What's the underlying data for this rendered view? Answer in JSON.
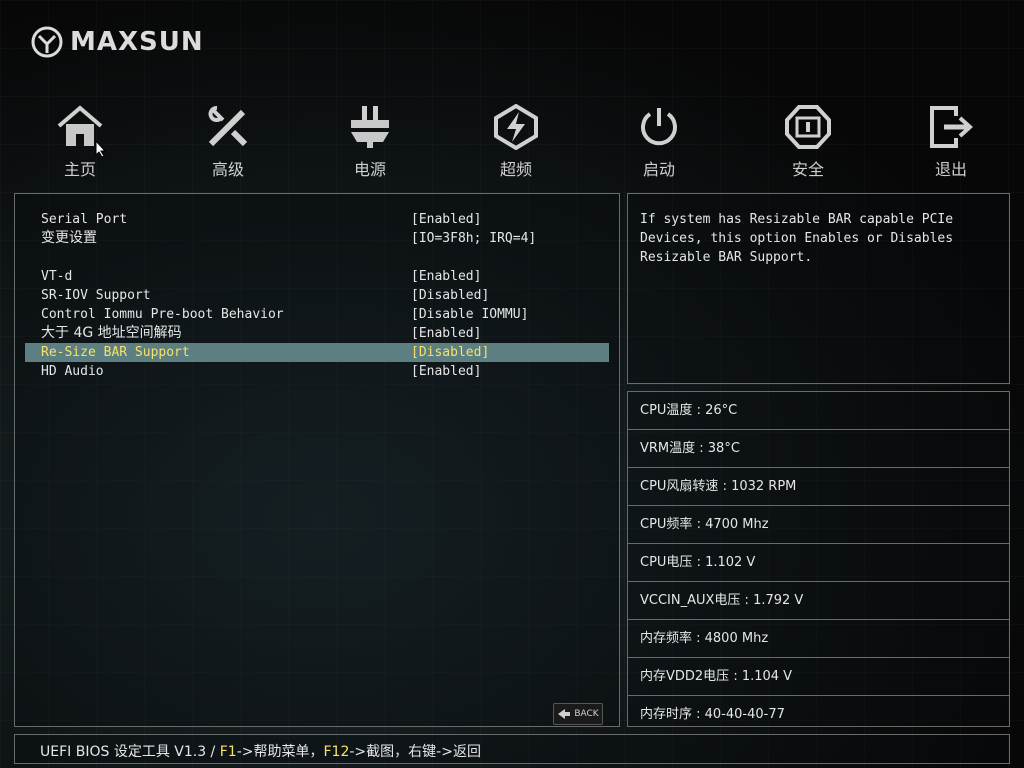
{
  "brand": "MAXSUN",
  "nav": [
    {
      "label": "主页",
      "icon": "home-icon"
    },
    {
      "label": "高级",
      "icon": "tools-icon"
    },
    {
      "label": "电源",
      "icon": "power-plug-icon"
    },
    {
      "label": "超频",
      "icon": "overclock-icon"
    },
    {
      "label": "启动",
      "icon": "power-button-icon"
    },
    {
      "label": "安全",
      "icon": "shield-icon"
    },
    {
      "label": "退出",
      "icon": "exit-icon"
    }
  ],
  "settings": [
    {
      "label": "Serial Port",
      "value": "[Enabled]"
    },
    {
      "label": "变更设置",
      "value": "[IO=3F8h; IRQ=4]"
    },
    {
      "label": "VT-d",
      "value": "[Enabled]"
    },
    {
      "label": "SR-IOV Support",
      "value": "[Disabled]"
    },
    {
      "label": "Control Iommu Pre-boot Behavior",
      "value": "[Disable IOMMU]"
    },
    {
      "label": "大于 4G 地址空间解码",
      "value": "[Enabled]"
    },
    {
      "label": "Re-Size BAR Support",
      "value": "[Disabled]"
    },
    {
      "label": "HD Audio",
      "value": "[Enabled]"
    }
  ],
  "back_label": "BACK",
  "help_text": "If system has Resizable BAR capable PCIe\nDevices, this option Enables or Disables\nResizable BAR Support.",
  "hardware": [
    "CPU温度 : 26°C",
    "VRM温度 : 38°C",
    "CPU风扇转速 : 1032 RPM",
    "CPU频率 : 4700 Mhz",
    "CPU电压 : 1.102 V",
    "VCCIN_AUX电压 : 1.792 V",
    "内存频率 : 4800 Mhz",
    "内存VDD2电压 : 1.104 V",
    "内存时序 : 40-40-40-77"
  ],
  "footer": {
    "prefix": "UEFI BIOS 设定工具 V1.3 / ",
    "key1": "F1",
    "text1": "->帮助菜单，",
    "key2": "F12",
    "text2": "->截图，右键->返回"
  },
  "colors": {
    "selected_bg": "#5d7f82",
    "selected_text": "#f5e26a",
    "border": "#6a6a6a"
  }
}
